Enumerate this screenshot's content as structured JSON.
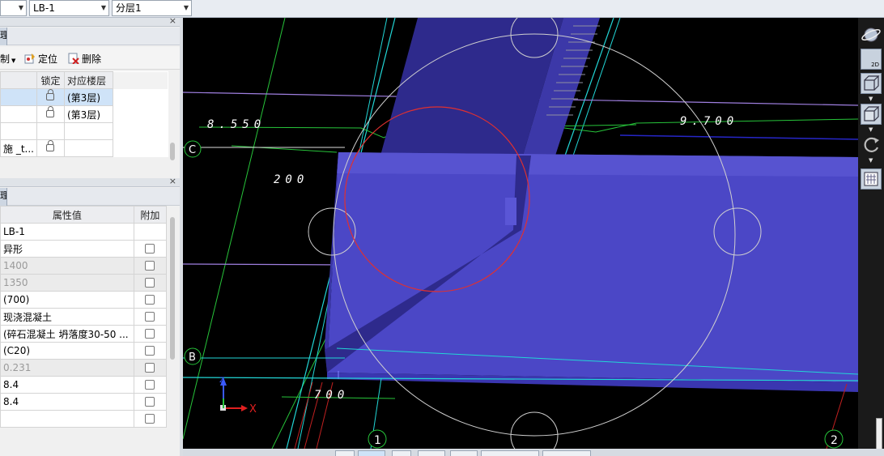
{
  "toolbar": {
    "combo1_value": "",
    "combo2_value": "LB-1",
    "combo3_value": "分层1"
  },
  "layer_panel": {
    "tab_stub_text": "理",
    "actions": [
      {
        "icon": "copy-icon",
        "label": "制"
      },
      {
        "icon": "locate-icon",
        "label": "定位"
      },
      {
        "icon": "delete-icon",
        "label": "删除"
      }
    ],
    "columns": [
      "",
      "锁定",
      "对应楼层"
    ],
    "rows": [
      {
        "name": "",
        "floor": "(第3层)",
        "selected": true
      },
      {
        "name": "",
        "floor": "(第3层)",
        "selected": false
      },
      {
        "name": "",
        "floor": "",
        "selected": false
      },
      {
        "name": "施 _t...",
        "floor": "",
        "selected": false
      }
    ]
  },
  "property_panel": {
    "tab_stub_text": "理",
    "columns": [
      "属性值",
      "附加"
    ],
    "rows": [
      {
        "value": "LB-1",
        "muted": false,
        "has_checkbox": false
      },
      {
        "value": "异形",
        "muted": false,
        "has_checkbox": true
      },
      {
        "value": "1400",
        "muted": true,
        "has_checkbox": true
      },
      {
        "value": "1350",
        "muted": true,
        "has_checkbox": true
      },
      {
        "value": "(700)",
        "muted": false,
        "has_checkbox": true
      },
      {
        "value": "现浇混凝土",
        "muted": false,
        "has_checkbox": true
      },
      {
        "value": "(碎石混凝土 坍落度30-50 ...",
        "muted": false,
        "has_checkbox": true
      },
      {
        "value": "(C20)",
        "muted": false,
        "has_checkbox": true
      },
      {
        "value": "0.231",
        "muted": true,
        "has_checkbox": true
      },
      {
        "value": "8.4",
        "muted": false,
        "has_checkbox": true
      },
      {
        "value": "8.4",
        "muted": false,
        "has_checkbox": true
      },
      {
        "value": "",
        "muted": false,
        "has_checkbox": true
      }
    ]
  },
  "viewport": {
    "dim_labels": [
      "8.550",
      "9.700",
      "200",
      "700"
    ],
    "axis_labels": {
      "C": "C",
      "B": "B",
      "1": "1",
      "2": "2"
    },
    "ucs": {
      "x": "X",
      "z": "Z"
    }
  },
  "right_tools": {
    "view2d_label": "2D"
  },
  "colors": {
    "slab": "#4b47c6",
    "slab_dark": "#2e2a8c",
    "grid_cyan": "#22d6d6",
    "grid_green": "#27c43a",
    "purple_line": "#9f7fe0",
    "red_circle": "#e03030"
  }
}
